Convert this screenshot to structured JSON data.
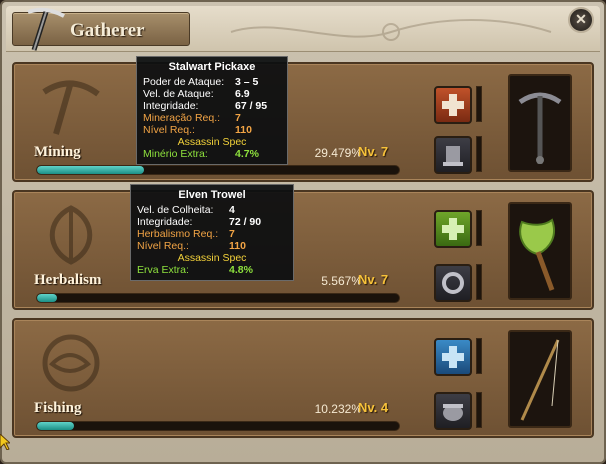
{
  "window": {
    "title": "Gatherer"
  },
  "skills": [
    {
      "name": "Mining",
      "percent_text": "29.479%",
      "level_text": "Nv. 7",
      "progress": 0.29479
    },
    {
      "name": "Herbalism",
      "percent_text": "5.567%",
      "level_text": "Nv. 7",
      "progress": 0.05567
    },
    {
      "name": "Fishing",
      "percent_text": "10.232%",
      "level_text": "Nv. 4",
      "progress": 0.10232
    }
  ],
  "tooltip_mining": {
    "title": "Stalwart Pickaxe",
    "rows": [
      {
        "k": "Poder de Ataque:",
        "v": "3 – 5"
      },
      {
        "k": "Vel. de Ataque:",
        "v": "6.9"
      },
      {
        "k": "Integridade:",
        "v": "67 / 95"
      },
      {
        "k": "Mineração Req.:",
        "v": "7"
      },
      {
        "k": "Nível Req.:",
        "v": "110"
      }
    ],
    "spec": "Assassin Spec",
    "bonus_k": "Minério Extra:",
    "bonus_v": "4.7%"
  },
  "tooltip_herbalism": {
    "title": "Elven Trowel",
    "rows": [
      {
        "k": "Vel. de Colheita:",
        "v": "4"
      },
      {
        "k": "Integridade:",
        "v": "72 / 90"
      },
      {
        "k": "Herbalismo Req.:",
        "v": "7"
      },
      {
        "k": "Nível Req.:",
        "v": "110"
      }
    ],
    "spec": "Assassin Spec",
    "bonus_k": "Erva Extra:",
    "bonus_v": "4.8%"
  },
  "colors": {
    "accent_gold": "#f7c23a",
    "xp_fill": "#3fb8ae",
    "tooltip_orange": "#f2a445",
    "tooltip_green": "#8ee13d"
  },
  "icons": [
    "pickaxe-emblem-icon",
    "leaf-emblem-icon",
    "fish-emblem-icon",
    "close-icon"
  ]
}
